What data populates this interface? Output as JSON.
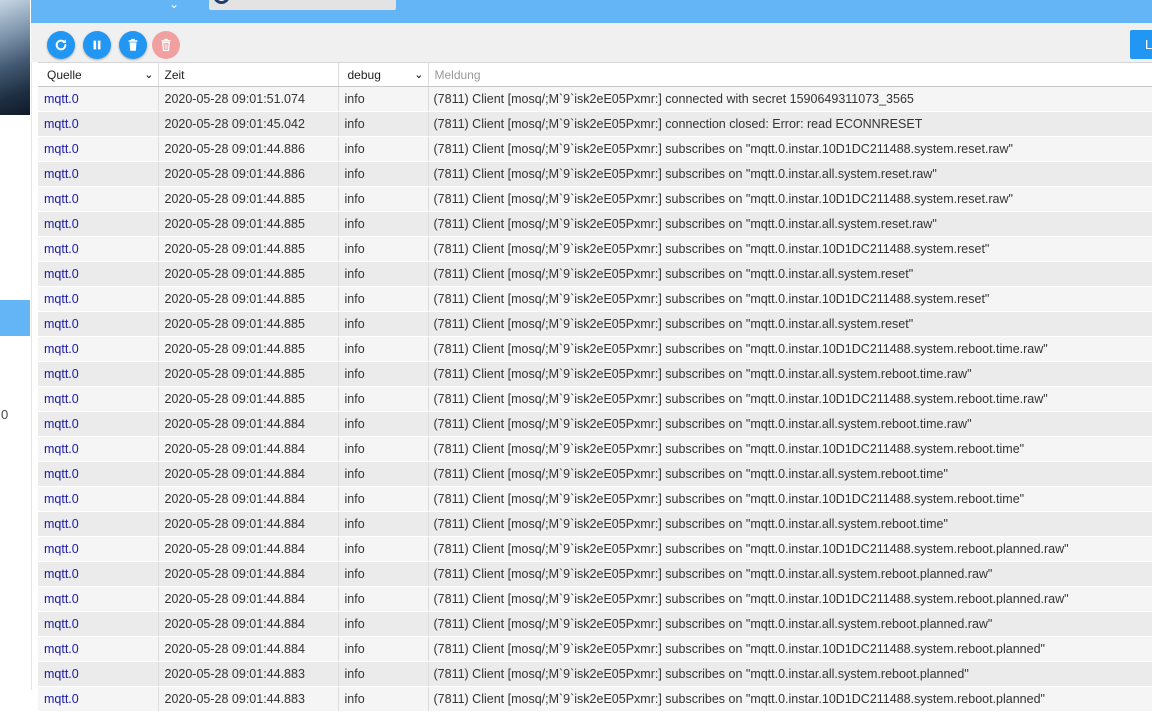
{
  "sidebar": {
    "partial_text": "0"
  },
  "toolbar": {
    "buttons": [
      {
        "name": "refresh-button",
        "icon": "refresh-icon"
      },
      {
        "name": "pause-button",
        "icon": "pause-icon"
      },
      {
        "name": "delete-button",
        "icon": "trash-icon"
      },
      {
        "name": "delete-all-button",
        "icon": "trash-outline-icon",
        "disabled": true
      }
    ],
    "right_button_label": "L"
  },
  "table": {
    "columns": {
      "source": "Quelle",
      "time": "Zeit",
      "level": "debug",
      "message": "Meldung"
    },
    "rows": [
      {
        "source": "mqtt.0",
        "time": "2020-05-28 09:01:51.074",
        "level": "info",
        "message": "(7811) Client [mosq/;M`9`isk2eE05Pxmr:] connected with secret 1590649311073_3565"
      },
      {
        "source": "mqtt.0",
        "time": "2020-05-28 09:01:45.042",
        "level": "info",
        "message": "(7811) Client [mosq/;M`9`isk2eE05Pxmr:] connection closed: Error: read ECONNRESET"
      },
      {
        "source": "mqtt.0",
        "time": "2020-05-28 09:01:44.886",
        "level": "info",
        "message": "(7811) Client [mosq/;M`9`isk2eE05Pxmr:] subscribes on \"mqtt.0.instar.10D1DC211488.system.reset.raw\""
      },
      {
        "source": "mqtt.0",
        "time": "2020-05-28 09:01:44.886",
        "level": "info",
        "message": "(7811) Client [mosq/;M`9`isk2eE05Pxmr:] subscribes on \"mqtt.0.instar.all.system.reset.raw\""
      },
      {
        "source": "mqtt.0",
        "time": "2020-05-28 09:01:44.885",
        "level": "info",
        "message": "(7811) Client [mosq/;M`9`isk2eE05Pxmr:] subscribes on \"mqtt.0.instar.10D1DC211488.system.reset.raw\""
      },
      {
        "source": "mqtt.0",
        "time": "2020-05-28 09:01:44.885",
        "level": "info",
        "message": "(7811) Client [mosq/;M`9`isk2eE05Pxmr:] subscribes on \"mqtt.0.instar.all.system.reset.raw\""
      },
      {
        "source": "mqtt.0",
        "time": "2020-05-28 09:01:44.885",
        "level": "info",
        "message": "(7811) Client [mosq/;M`9`isk2eE05Pxmr:] subscribes on \"mqtt.0.instar.10D1DC211488.system.reset\""
      },
      {
        "source": "mqtt.0",
        "time": "2020-05-28 09:01:44.885",
        "level": "info",
        "message": "(7811) Client [mosq/;M`9`isk2eE05Pxmr:] subscribes on \"mqtt.0.instar.all.system.reset\""
      },
      {
        "source": "mqtt.0",
        "time": "2020-05-28 09:01:44.885",
        "level": "info",
        "message": "(7811) Client [mosq/;M`9`isk2eE05Pxmr:] subscribes on \"mqtt.0.instar.10D1DC211488.system.reset\""
      },
      {
        "source": "mqtt.0",
        "time": "2020-05-28 09:01:44.885",
        "level": "info",
        "message": "(7811) Client [mosq/;M`9`isk2eE05Pxmr:] subscribes on \"mqtt.0.instar.all.system.reset\""
      },
      {
        "source": "mqtt.0",
        "time": "2020-05-28 09:01:44.885",
        "level": "info",
        "message": "(7811) Client [mosq/;M`9`isk2eE05Pxmr:] subscribes on \"mqtt.0.instar.10D1DC211488.system.reboot.time.raw\""
      },
      {
        "source": "mqtt.0",
        "time": "2020-05-28 09:01:44.885",
        "level": "info",
        "message": "(7811) Client [mosq/;M`9`isk2eE05Pxmr:] subscribes on \"mqtt.0.instar.all.system.reboot.time.raw\""
      },
      {
        "source": "mqtt.0",
        "time": "2020-05-28 09:01:44.885",
        "level": "info",
        "message": "(7811) Client [mosq/;M`9`isk2eE05Pxmr:] subscribes on \"mqtt.0.instar.10D1DC211488.system.reboot.time.raw\""
      },
      {
        "source": "mqtt.0",
        "time": "2020-05-28 09:01:44.884",
        "level": "info",
        "message": "(7811) Client [mosq/;M`9`isk2eE05Pxmr:] subscribes on \"mqtt.0.instar.all.system.reboot.time.raw\""
      },
      {
        "source": "mqtt.0",
        "time": "2020-05-28 09:01:44.884",
        "level": "info",
        "message": "(7811) Client [mosq/;M`9`isk2eE05Pxmr:] subscribes on \"mqtt.0.instar.10D1DC211488.system.reboot.time\""
      },
      {
        "source": "mqtt.0",
        "time": "2020-05-28 09:01:44.884",
        "level": "info",
        "message": "(7811) Client [mosq/;M`9`isk2eE05Pxmr:] subscribes on \"mqtt.0.instar.all.system.reboot.time\""
      },
      {
        "source": "mqtt.0",
        "time": "2020-05-28 09:01:44.884",
        "level": "info",
        "message": "(7811) Client [mosq/;M`9`isk2eE05Pxmr:] subscribes on \"mqtt.0.instar.10D1DC211488.system.reboot.time\""
      },
      {
        "source": "mqtt.0",
        "time": "2020-05-28 09:01:44.884",
        "level": "info",
        "message": "(7811) Client [mosq/;M`9`isk2eE05Pxmr:] subscribes on \"mqtt.0.instar.all.system.reboot.time\""
      },
      {
        "source": "mqtt.0",
        "time": "2020-05-28 09:01:44.884",
        "level": "info",
        "message": "(7811) Client [mosq/;M`9`isk2eE05Pxmr:] subscribes on \"mqtt.0.instar.10D1DC211488.system.reboot.planned.raw\""
      },
      {
        "source": "mqtt.0",
        "time": "2020-05-28 09:01:44.884",
        "level": "info",
        "message": "(7811) Client [mosq/;M`9`isk2eE05Pxmr:] subscribes on \"mqtt.0.instar.all.system.reboot.planned.raw\""
      },
      {
        "source": "mqtt.0",
        "time": "2020-05-28 09:01:44.884",
        "level": "info",
        "message": "(7811) Client [mosq/;M`9`isk2eE05Pxmr:] subscribes on \"mqtt.0.instar.10D1DC211488.system.reboot.planned.raw\""
      },
      {
        "source": "mqtt.0",
        "time": "2020-05-28 09:01:44.884",
        "level": "info",
        "message": "(7811) Client [mosq/;M`9`isk2eE05Pxmr:] subscribes on \"mqtt.0.instar.all.system.reboot.planned.raw\""
      },
      {
        "source": "mqtt.0",
        "time": "2020-05-28 09:01:44.884",
        "level": "info",
        "message": "(7811) Client [mosq/;M`9`isk2eE05Pxmr:] subscribes on \"mqtt.0.instar.10D1DC211488.system.reboot.planned\""
      },
      {
        "source": "mqtt.0",
        "time": "2020-05-28 09:01:44.883",
        "level": "info",
        "message": "(7811) Client [mosq/;M`9`isk2eE05Pxmr:] subscribes on \"mqtt.0.instar.all.system.reboot.planned\""
      },
      {
        "source": "mqtt.0",
        "time": "2020-05-28 09:01:44.883",
        "level": "info",
        "message": "(7811) Client [mosq/;M`9`isk2eE05Pxmr:] subscribes on \"mqtt.0.instar.10D1DC211488.system.reboot.planned\""
      }
    ]
  },
  "colors": {
    "header": "#64b5f6",
    "button": "#2196f3",
    "button_disabled": "#f0a0a0",
    "source_link": "#1a1aa6",
    "row_odd": "#f5f5f5",
    "row_even": "#ebebeb"
  }
}
